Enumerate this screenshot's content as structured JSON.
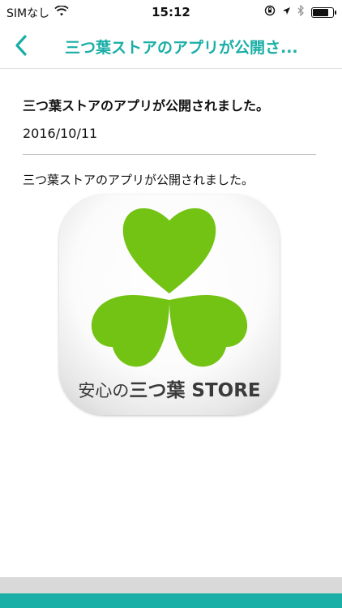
{
  "status_bar": {
    "carrier": "SIMなし",
    "time": "15:12",
    "battery_level": 0.85
  },
  "nav": {
    "title": "三つ葉ストアのアプリが公開さ...",
    "accent_color": "#19aea6"
  },
  "article": {
    "title": "三つ葉ストアのアプリが公開されました。",
    "date": "2016/10/11",
    "body": "三つ葉ストアのアプリが公開されました。"
  },
  "app_icon": {
    "text_prefix": "安心の",
    "text_strong": "三つ葉 STORE",
    "leaf_color": "#72c313"
  }
}
